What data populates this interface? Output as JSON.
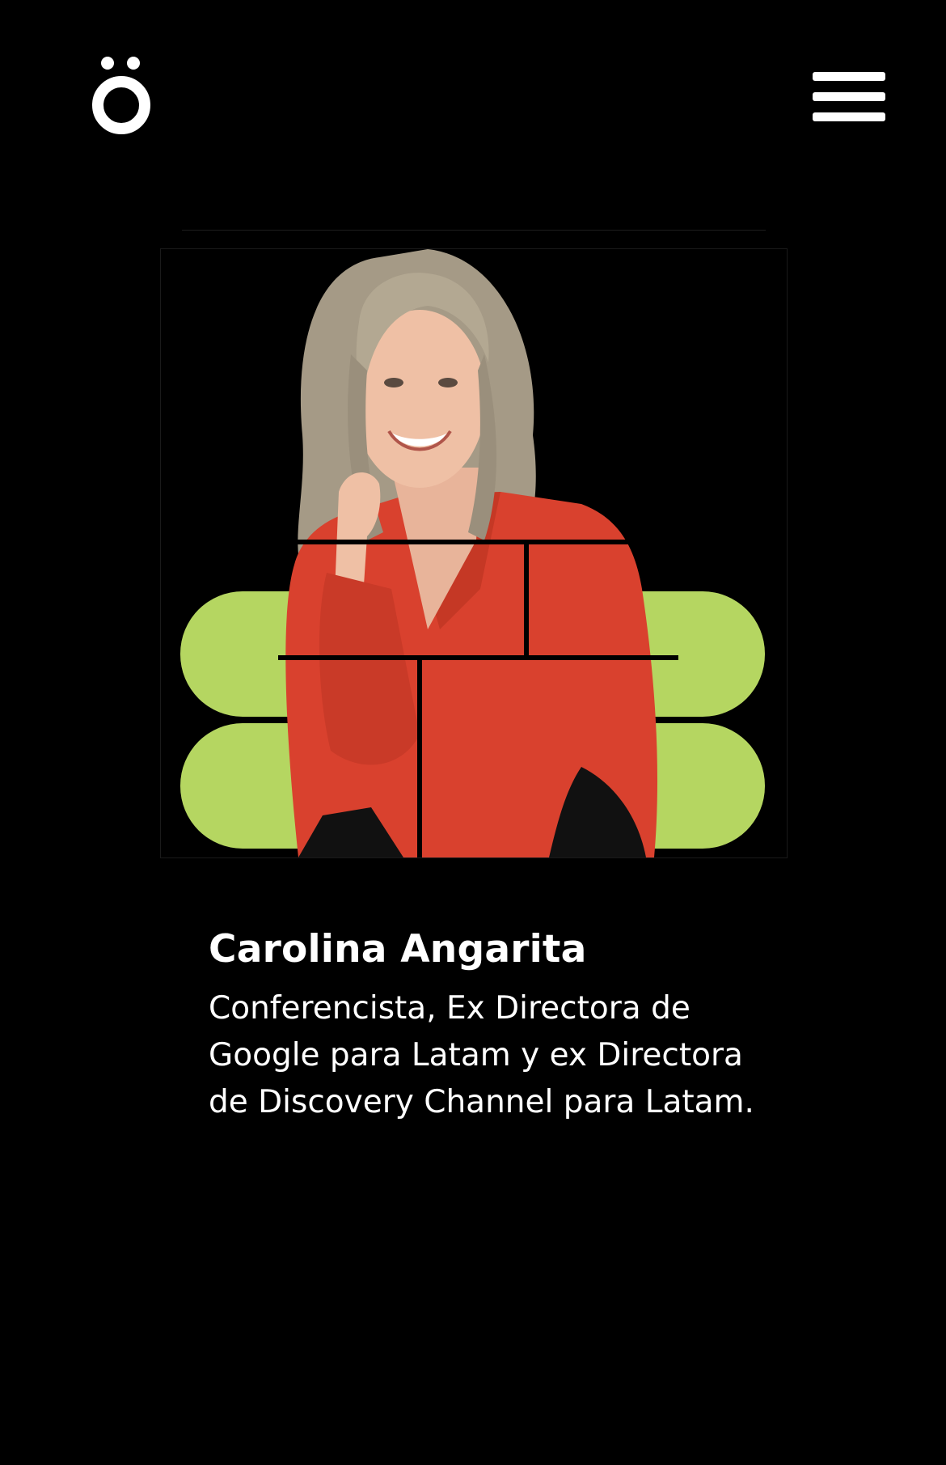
{
  "header": {
    "logo_icon": "o-umlaut-logo",
    "menu_icon": "hamburger-menu-icon"
  },
  "speaker": {
    "name": "Carolina Angarita",
    "role": "Conferencista, Ex Directora de Google para Latam y ex Directora de Discovery Channel para Latam."
  },
  "colors": {
    "background": "#000000",
    "text": "#ffffff",
    "accent_green": "#b5d661",
    "blouse_red": "#d9412e",
    "hair": "#a59a86"
  }
}
